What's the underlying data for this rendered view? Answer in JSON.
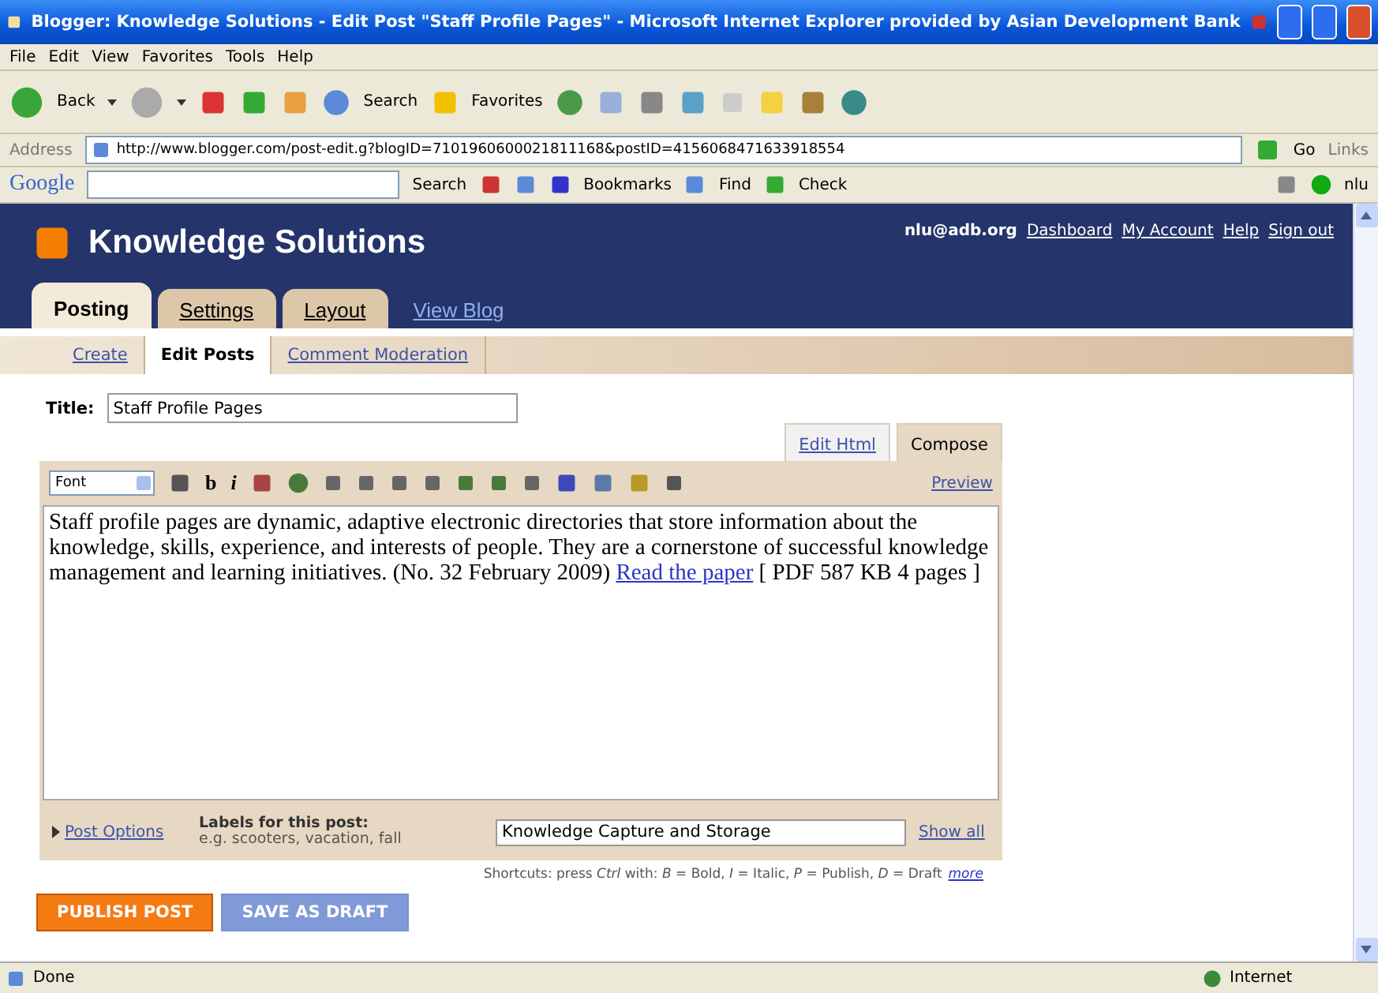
{
  "window": {
    "title": "Blogger: Knowledge Solutions - Edit Post \"Staff Profile Pages\" - Microsoft Internet Explorer provided by Asian Development Bank"
  },
  "menu": [
    "File",
    "Edit",
    "View",
    "Favorites",
    "Tools",
    "Help"
  ],
  "toolbar": {
    "back": "Back",
    "search": "Search",
    "favorites": "Favorites"
  },
  "address": {
    "label": "Address",
    "url": "http://www.blogger.com/post-edit.g?blogID=7101960600021811168&postID=4156068471633918554",
    "go": "Go",
    "links": "Links"
  },
  "google_bar": {
    "logo": "Google",
    "search": "Search",
    "bookmarks": "Bookmarks",
    "find": "Find",
    "check": "Check",
    "user": "nlu"
  },
  "blog": {
    "title": "Knowledge Solutions",
    "email": "nlu@adb.org",
    "links": [
      "Dashboard",
      "My Account",
      "Help",
      "Sign out"
    ]
  },
  "tabs": [
    {
      "label": "Posting",
      "selected": true
    },
    {
      "label": "Settings",
      "selected": false
    },
    {
      "label": "Layout",
      "selected": false
    }
  ],
  "view_blog": "View Blog",
  "subtabs": [
    {
      "label": "Create",
      "selected": false
    },
    {
      "label": "Edit Posts",
      "selected": true
    },
    {
      "label": "Comment Moderation",
      "selected": false
    }
  ],
  "post": {
    "title_label": "Title:",
    "title": "Staff Profile Pages",
    "editor_tabs": [
      {
        "label": "Edit Html",
        "selected": false
      },
      {
        "label": "Compose",
        "selected": true
      }
    ],
    "font": "Font",
    "bold": "b",
    "italic": "i",
    "preview": "Preview",
    "body_before": "Staff profile pages are dynamic, adaptive electronic directories that store information about the knowledge, skills, experience, and interests of people. They are a cornerstone of successful knowledge management and learning initiatives. (No. 32 February 2009)",
    "body_link": "Read the paper",
    "body_after": "[ PDF 587 KB 4 pages ]",
    "post_options": "Post Options",
    "labels_heading": "Labels for this post:",
    "labels_hint": "e.g. scooters, vacation, fall",
    "labels": "Knowledge Capture and Storage",
    "show_all": "Show all",
    "shortcuts": "Shortcuts: press *Ctrl* with: *B* = Bold, *I* = Italic, *P* = Publish, *D* = Draft",
    "shortcuts_more": "more"
  },
  "buttons": {
    "publish": "PUBLISH POST",
    "draft": "SAVE AS DRAFT"
  },
  "status_bar": {
    "text": "Done",
    "zone": "Internet"
  }
}
